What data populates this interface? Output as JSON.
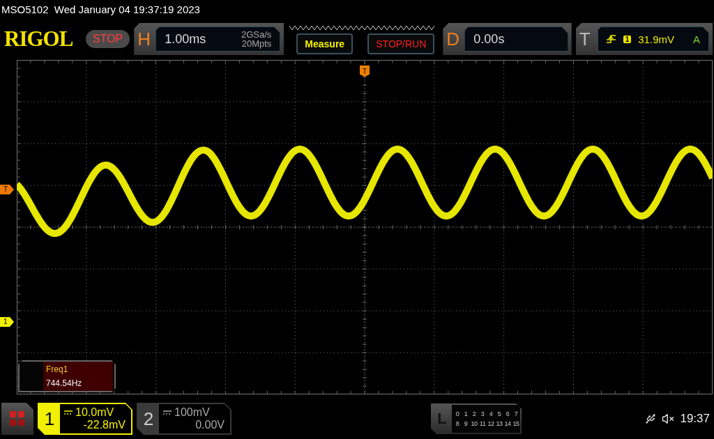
{
  "status_line": "MSO5102  Wed January 04 19:37:19 2023",
  "logo": "RIGOL",
  "run_state": "STOP",
  "horizontal": {
    "label": "H",
    "timebase": "1.00ms",
    "sample_rate": "2GSa/s",
    "memory_depth": "20Mpts"
  },
  "buttons": [
    "Measure",
    "STOP/RUN"
  ],
  "delay": {
    "label": "D",
    "value": "0.00s"
  },
  "trigger": {
    "label": "T",
    "source": "1",
    "level": "31.9mV",
    "mode": "A"
  },
  "markers": {
    "trigger_position": "T",
    "trigger_level": "T",
    "channel_1": "1"
  },
  "measurement": {
    "name": "Freq1",
    "value": "744.54Hz"
  },
  "channels": [
    {
      "number": "1",
      "scale": "10.0mV",
      "offset": "-22.8mV",
      "selected": true
    },
    {
      "number": "2",
      "scale": "100mV",
      "offset": "0.00V",
      "selected": false
    }
  ],
  "logic": {
    "label": "L",
    "rows": [
      [
        "0",
        "1",
        "2",
        "3",
        "4",
        "5",
        "6",
        "7"
      ],
      [
        "8",
        "9",
        "10",
        "11",
        "12",
        "13",
        "14",
        "15"
      ]
    ]
  },
  "clock": "19:37"
}
